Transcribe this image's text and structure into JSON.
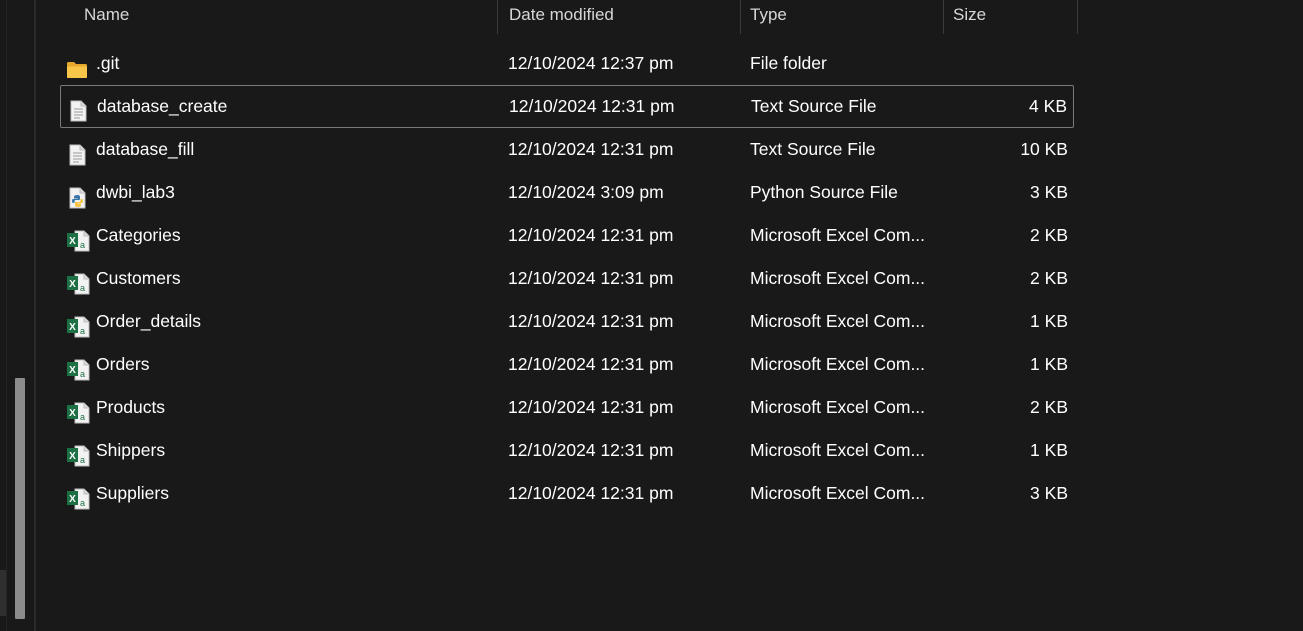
{
  "columns": {
    "name": "Name",
    "date": "Date modified",
    "type": "Type",
    "size": "Size"
  },
  "files": [
    {
      "name": ".git",
      "date": "12/10/2024 12:37 pm",
      "type": "File folder",
      "size": "",
      "icon": "folder-icon"
    },
    {
      "name": "database_create",
      "date": "12/10/2024 12:31 pm",
      "type": "Text Source File",
      "size": "4 KB",
      "icon": "text-file-icon",
      "selected": true
    },
    {
      "name": "database_fill",
      "date": "12/10/2024 12:31 pm",
      "type": "Text Source File",
      "size": "10 KB",
      "icon": "text-file-icon"
    },
    {
      "name": "dwbi_lab3",
      "date": "12/10/2024 3:09 pm",
      "type": "Python Source File",
      "size": "3 KB",
      "icon": "python-file-icon"
    },
    {
      "name": "Categories",
      "date": "12/10/2024 12:31 pm",
      "type": "Microsoft Excel Com...",
      "size": "2 KB",
      "icon": "excel-file-icon"
    },
    {
      "name": "Customers",
      "date": "12/10/2024 12:31 pm",
      "type": "Microsoft Excel Com...",
      "size": "2 KB",
      "icon": "excel-file-icon"
    },
    {
      "name": "Order_details",
      "date": "12/10/2024 12:31 pm",
      "type": "Microsoft Excel Com...",
      "size": "1 KB",
      "icon": "excel-file-icon"
    },
    {
      "name": "Orders",
      "date": "12/10/2024 12:31 pm",
      "type": "Microsoft Excel Com...",
      "size": "1 KB",
      "icon": "excel-file-icon"
    },
    {
      "name": "Products",
      "date": "12/10/2024 12:31 pm",
      "type": "Microsoft Excel Com...",
      "size": "2 KB",
      "icon": "excel-file-icon"
    },
    {
      "name": "Shippers",
      "date": "12/10/2024 12:31 pm",
      "type": "Microsoft Excel Com...",
      "size": "1 KB",
      "icon": "excel-file-icon"
    },
    {
      "name": "Suppliers",
      "date": "12/10/2024 12:31 pm",
      "type": "Microsoft Excel Com...",
      "size": "3 KB",
      "icon": "excel-file-icon"
    }
  ],
  "colors": {
    "background": "#191919",
    "text": "#ffffff",
    "header_text": "#d7d7d7",
    "selection_border": "#7a7a7a",
    "folder": "#f3c24c",
    "excel": "#1d7044"
  }
}
